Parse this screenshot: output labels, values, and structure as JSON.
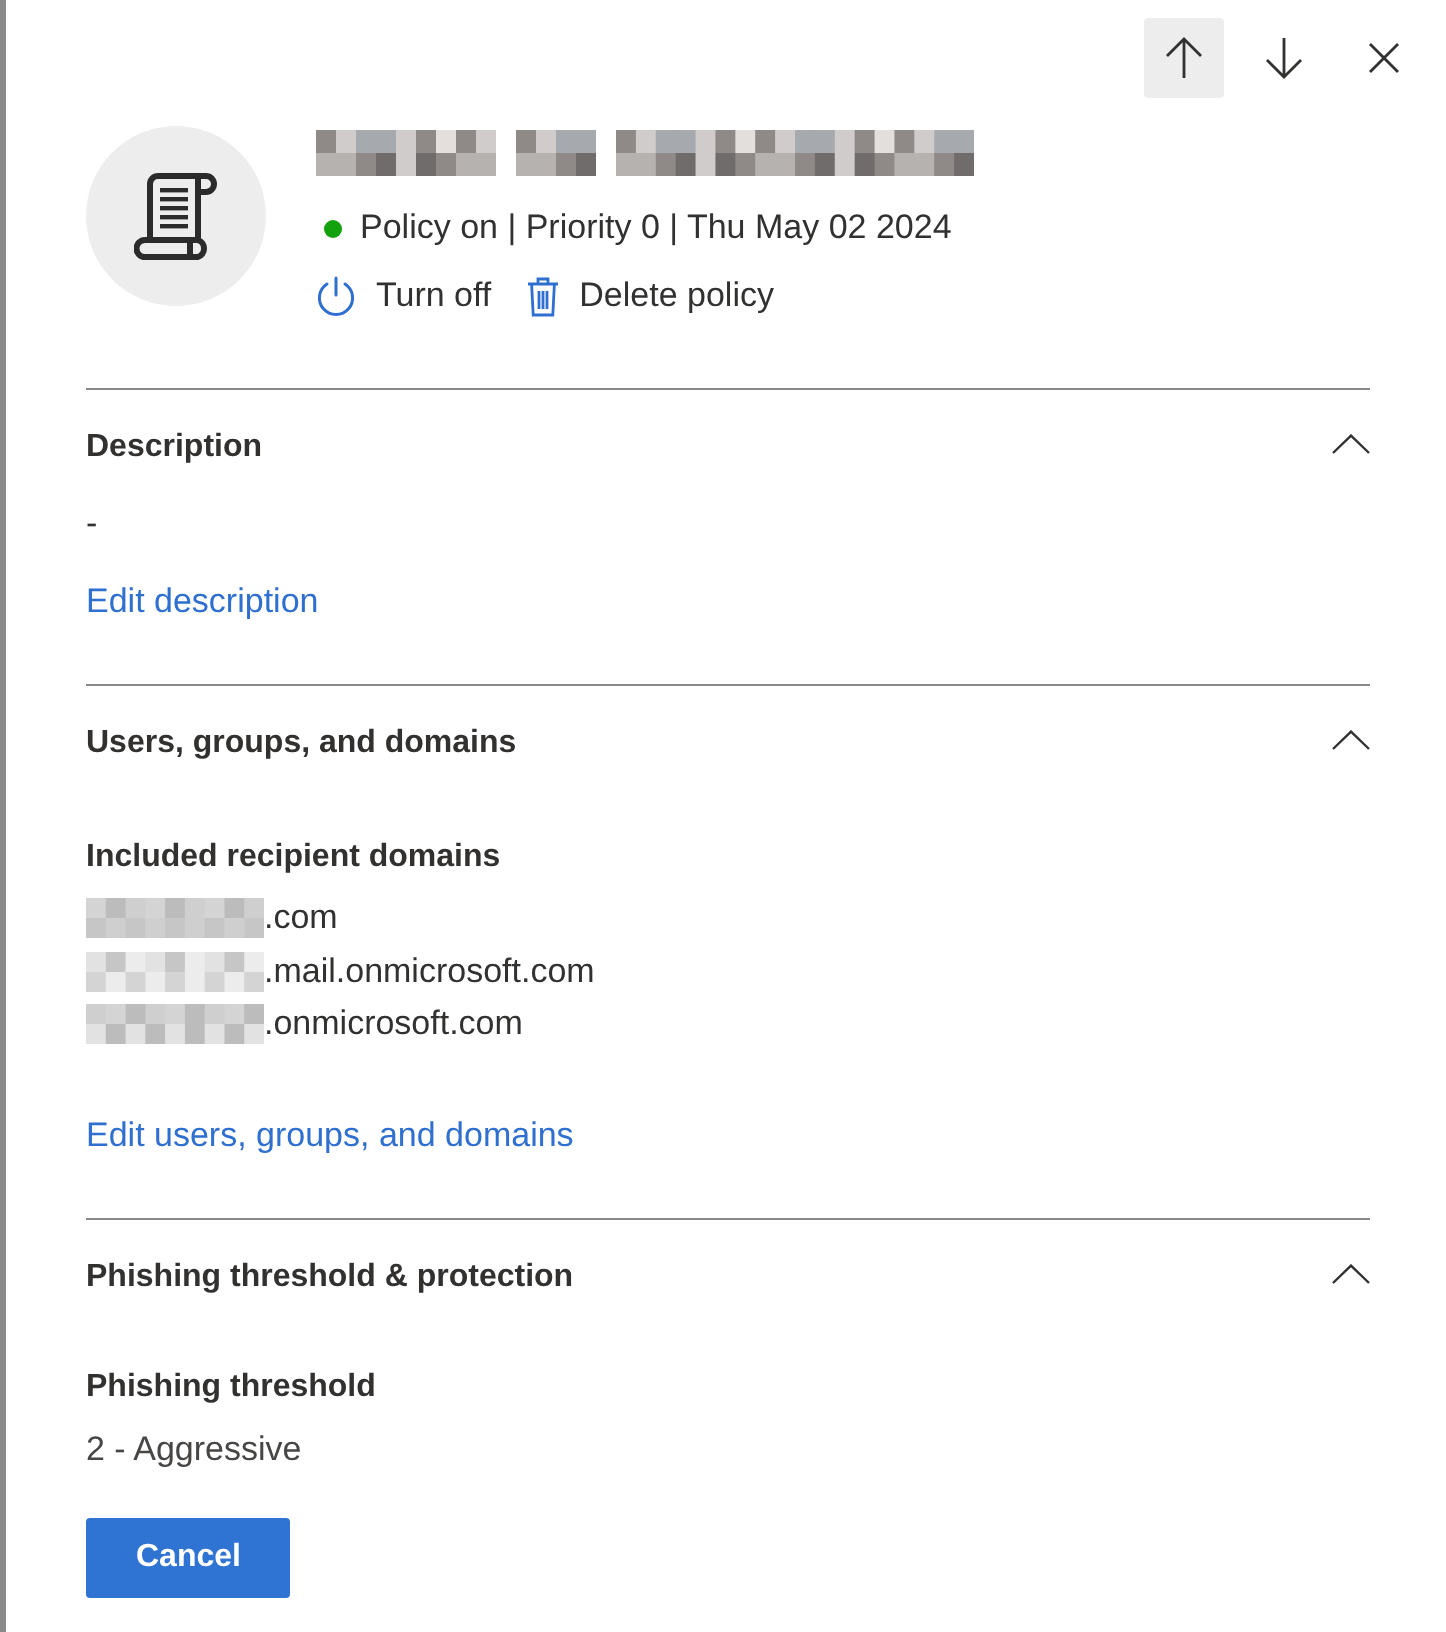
{
  "toolbar": [
    {
      "kind": "up",
      "focused": true
    },
    {
      "kind": "down",
      "focused": false
    },
    {
      "kind": "close",
      "focused": false
    }
  ],
  "header": {
    "status": {
      "on": true,
      "text": "Policy on | Priority 0 | Thu May 02 2024"
    },
    "actions": [
      {
        "kind": "power",
        "label": "Turn off"
      },
      {
        "kind": "delete",
        "label": "Delete policy"
      }
    ]
  },
  "sections": [
    {
      "kind": "description",
      "title": "Description",
      "expanded": true,
      "text": "-",
      "link": "Edit description"
    },
    {
      "kind": "domains",
      "title": "Users, groups, and domains",
      "expanded": true,
      "subheading": "Included recipient domains",
      "items": [
        {
          "redacted": true,
          "text": ".com"
        },
        {
          "redacted": true,
          "text": ".mail.onmicrosoft.com"
        },
        {
          "redacted": true,
          "text": ".onmicrosoft.com"
        }
      ],
      "link": "Edit users, groups, and domains"
    },
    {
      "kind": "setting",
      "title": "Phishing threshold & protection",
      "expanded": true,
      "label": "Phishing threshold",
      "value": "2 - Aggressive"
    }
  ],
  "footer": {
    "buttons": [
      {
        "kind": "primary",
        "label": "Cancel"
      }
    ]
  }
}
